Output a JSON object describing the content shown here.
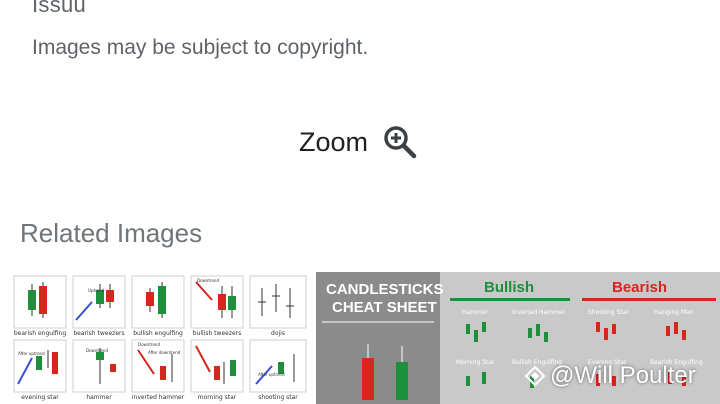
{
  "header": {
    "source": "Issuu",
    "copyright_notice": "Images may be subject to copyright."
  },
  "zoom": {
    "label": "Zoom",
    "icon": "zoom-in-icon"
  },
  "related": {
    "title": "Related Images",
    "thumb1": {
      "labels": [
        "bearish engulfing",
        "bearish tweezers",
        "bullish engulfing",
        "bullish tweezers",
        "dojis",
        "evening star",
        "hammer",
        "inverted hammer",
        "morning star",
        "shooting star"
      ],
      "annotations": [
        "Uptrend",
        "Downtrend",
        "Downtrend",
        "After uptrend",
        "Downtrend",
        "After downtrend",
        "After uptrend"
      ]
    },
    "thumb2": {
      "title_line1": "CANDLESTICKS",
      "title_line2": "CHEAT SHEET",
      "bullish": "Bullish",
      "bearish": "Bearish",
      "bull_patterns": [
        "Hammer",
        "Inverted Hammer",
        "Morning Star",
        "Bullish Engulfing"
      ],
      "bear_patterns": [
        "Shooting Star",
        "Hanging Man",
        "Evening Star",
        "Bearish Engulfing"
      ],
      "watermark": "@Will Poulter"
    }
  },
  "colors": {
    "bull_green": "#1e8f3a",
    "bear_red": "#d7261e",
    "text_gray": "#5f6368"
  }
}
